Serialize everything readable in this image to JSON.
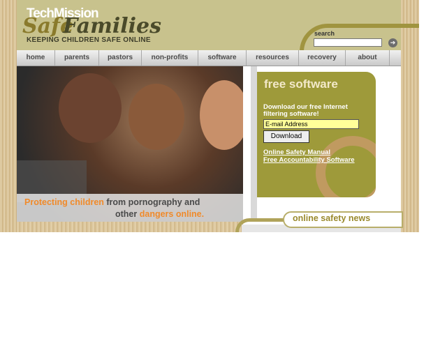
{
  "header": {
    "logo_top": "TechMission",
    "logo_safe": "Safe",
    "logo_families": "Families",
    "tagline": "KEEPING CHILDREN SAFE ONLINE",
    "search_label": "search",
    "search_value": "",
    "go_icon": "arrow-right-icon"
  },
  "nav": {
    "items": [
      {
        "label": "home"
      },
      {
        "label": "parents"
      },
      {
        "label": "pastors"
      },
      {
        "label": "non-profits"
      },
      {
        "label": "software"
      },
      {
        "label": "resources"
      },
      {
        "label": "recovery"
      },
      {
        "label": "about"
      }
    ]
  },
  "hero": {
    "caption_part1_orange": "Protecting children",
    "caption_part1_rest": " from pornography and",
    "caption_part2_plain": "other ",
    "caption_part2_orange": "dangers online."
  },
  "free_software": {
    "title": "free software",
    "description": "Download our free Internet filtering software!",
    "email_value": "E-mail Address",
    "download_label": "Download",
    "links": [
      "Online Safety Manual",
      "Free Accountability Software"
    ]
  },
  "news": {
    "title": "online safety news"
  },
  "colors": {
    "header_bg": "#c8c28d",
    "olive": "#9e9a3a",
    "orange": "#f08a2a"
  }
}
